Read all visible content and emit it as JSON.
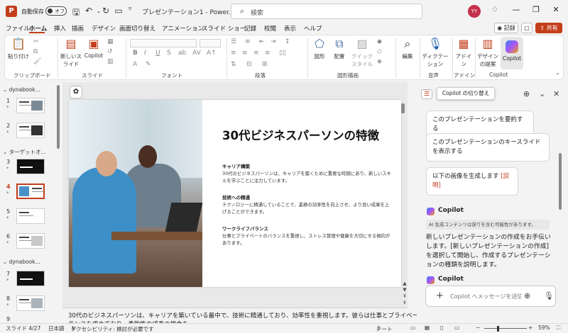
{
  "titlebar": {
    "autosave_label": "自動保存",
    "autosave_state": "オフ",
    "doc_title": "プレゼンテーション1 - Power...",
    "search_placeholder": "検索",
    "user_initials": "YY"
  },
  "menu": {
    "tabs": [
      "ファイル",
      "ホーム",
      "挿入",
      "描画",
      "デザイン",
      "画面切り替え",
      "アニメーション",
      "スライド ショー",
      "記録",
      "校閲",
      "表示",
      "ヘルプ"
    ],
    "active": "ホーム",
    "record_label": "記録",
    "share_label": "共有"
  },
  "ribbon": {
    "paste_label": "貼り付け",
    "new_slide_label": "新しいスライド",
    "copilot_small_label": "Copilot",
    "shapes_label": "図形",
    "arrange_label": "配置",
    "quick_styles_label": "クイックスタイル",
    "edit_label": "編集",
    "dictation_label": "ディクテーション",
    "addins_label": "アドイン",
    "designer_label": "デザインの提案",
    "copilot_label": "Copilot",
    "groups": {
      "clipboard": "クリップボード",
      "slides": "スライド",
      "font": "フォント",
      "paragraph": "段落",
      "drawing": "図形描画",
      "voice": "音声",
      "addins": "アドイン",
      "copilot": "Copilot"
    }
  },
  "thumbnails": {
    "sections": [
      "dynabook...",
      "ターゲットオ...",
      "dynabook..."
    ],
    "slide_numbers": [
      "1",
      "2",
      "3",
      "4",
      "5",
      "6",
      "7",
      "8",
      "9"
    ],
    "star": "*"
  },
  "slide": {
    "title": "30代ビジネスパーソンの特徴",
    "sections": [
      {
        "heading": "キャリア構築",
        "body": "30代のビジネスパーソンは、キャリアを築くために重要な時期にあり、新しいスキルを学ぶことに注力しています。"
      },
      {
        "heading": "技術への精通",
        "body": "テクノロジーに精通していることで、業務の効率性を向上させ、より良い成果を上げることができます。"
      },
      {
        "heading": "ワークライフバランス",
        "body": "仕事とプライベートのバランスを重視し、ストレス管理や健康を大切にする傾向があります。"
      }
    ]
  },
  "notes": {
    "line1": "30代のビジネスパーソンは、キャリアを築いている最中で、技術に精通しており、効率性を重視します。彼らは仕事とプライベートのバ",
    "line2": "ランスを求めており、柔軟性や成長の機会を..."
  },
  "copilot": {
    "tooltip": "Copilot の切り替え",
    "suggestions": [
      "このプレゼンテーションを要約する",
      "このプレゼンテーションのキースライドを表示する"
    ],
    "suggestion3_text": "以下の画像を生成します",
    "suggestion3_link": "[説明]",
    "name": "Copilot",
    "ai_note": "AI 生成コンテンツは誤りを含む可能性があります。",
    "message": "新しいプレゼンテーションの作成をお手伝いします。[新しいプレゼンテーションの作成]を選択して開始し、作成するプレゼンテーションの種類を説明します。",
    "input_placeholder": "Copilot へメッセージを送信"
  },
  "statusbar": {
    "slide_info": "スライド 4/27",
    "language": "日本語",
    "accessibility": "アクセシビリティ: 検討が必要です",
    "notes_label": "ノート",
    "zoom": "59%"
  }
}
